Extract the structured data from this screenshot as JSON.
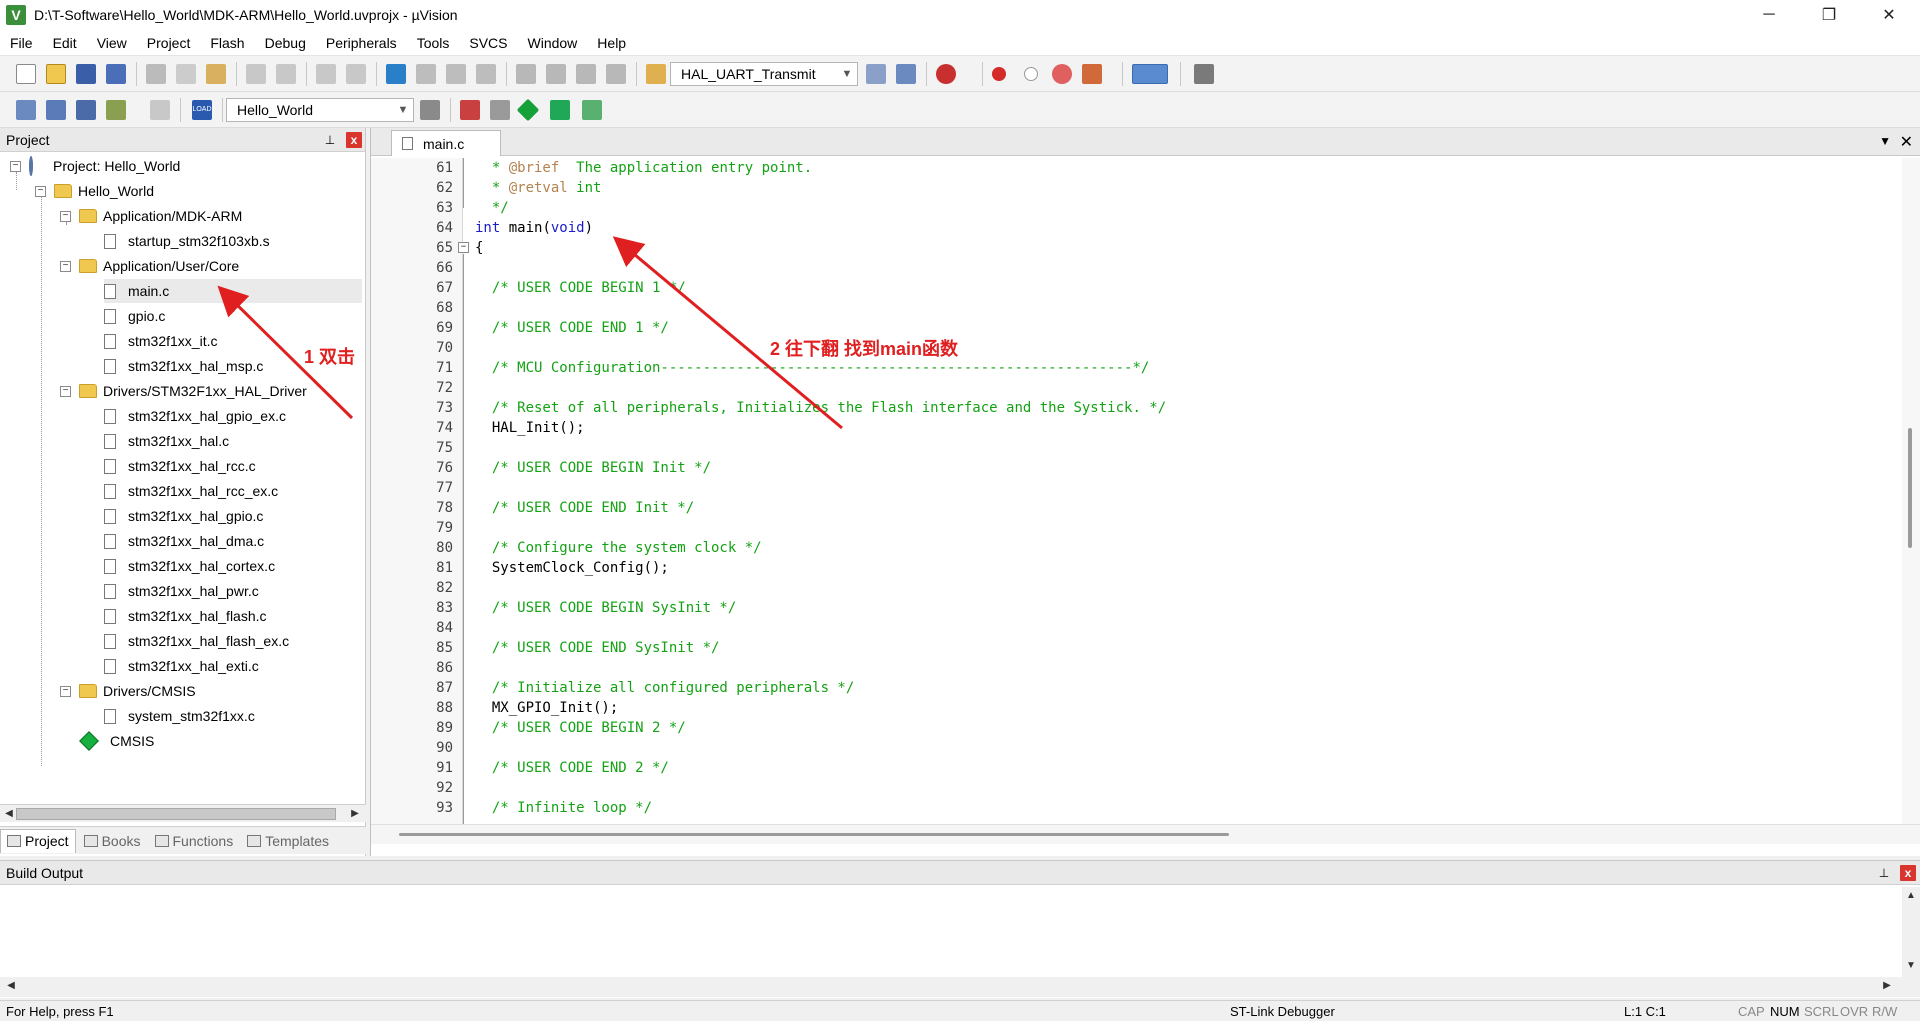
{
  "window": {
    "icon_letter": "V",
    "title": "D:\\T-Software\\Hello_World\\MDK-ARM\\Hello_World.uvprojx - µVision",
    "minimize": "─",
    "maximize": "❐",
    "close": "✕"
  },
  "menu": [
    "File",
    "Edit",
    "View",
    "Project",
    "Flash",
    "Debug",
    "Peripherals",
    "Tools",
    "SVCS",
    "Window",
    "Help"
  ],
  "toolbar": {
    "find_combo_value": "HAL_UART_Transmit",
    "target_combo_value": "Hello_World",
    "load_label": "LOAD"
  },
  "project_panel": {
    "title": "Project",
    "pin": "📌",
    "close": "x",
    "tree": {
      "root": "Project: Hello_World",
      "target": "Hello_World",
      "groups": [
        {
          "name": "Application/MDK-ARM",
          "files": [
            "startup_stm32f103xb.s"
          ]
        },
        {
          "name": "Application/User/Core",
          "files": [
            "main.c",
            "gpio.c",
            "stm32f1xx_it.c",
            "stm32f1xx_hal_msp.c"
          ]
        },
        {
          "name": "Drivers/STM32F1xx_HAL_Driver",
          "files": [
            "stm32f1xx_hal_gpio_ex.c",
            "stm32f1xx_hal.c",
            "stm32f1xx_hal_rcc.c",
            "stm32f1xx_hal_rcc_ex.c",
            "stm32f1xx_hal_gpio.c",
            "stm32f1xx_hal_dma.c",
            "stm32f1xx_hal_cortex.c",
            "stm32f1xx_hal_pwr.c",
            "stm32f1xx_hal_flash.c",
            "stm32f1xx_hal_flash_ex.c",
            "stm32f1xx_hal_exti.c"
          ]
        },
        {
          "name": "Drivers/CMSIS",
          "files": [
            "system_stm32f1xx.c"
          ]
        }
      ],
      "component": "CMSIS"
    },
    "tabs": [
      "Project",
      "Books",
      "Functions",
      "Templates"
    ]
  },
  "editor": {
    "tab": "main.c",
    "tab_list_arrow": "▼",
    "tab_close": "✕",
    "lines": [
      {
        "n": "61",
        "parts": [
          {
            "t": "  * ",
            "c": "c-comment"
          },
          {
            "t": "@brief",
            "c": "c-doc"
          },
          {
            "t": "  The application entry point.",
            "c": "c-comment"
          }
        ]
      },
      {
        "n": "62",
        "parts": [
          {
            "t": "  * ",
            "c": "c-comment"
          },
          {
            "t": "@retval",
            "c": "c-doc"
          },
          {
            "t": " int",
            "c": "c-comment"
          }
        ]
      },
      {
        "n": "63",
        "parts": [
          {
            "t": "  */",
            "c": "c-comment"
          }
        ]
      },
      {
        "n": "64",
        "parts": [
          {
            "t": "int",
            "c": "c-kw"
          },
          {
            "t": " main(",
            "c": "c-plain"
          },
          {
            "t": "void",
            "c": "c-kw"
          },
          {
            "t": ")",
            "c": "c-plain"
          }
        ]
      },
      {
        "n": "65",
        "parts": [
          {
            "t": "{",
            "c": "c-plain"
          }
        ]
      },
      {
        "n": "66",
        "parts": []
      },
      {
        "n": "67",
        "parts": [
          {
            "t": "  /* USER CODE BEGIN 1 */",
            "c": "c-comment"
          }
        ]
      },
      {
        "n": "68",
        "parts": []
      },
      {
        "n": "69",
        "parts": [
          {
            "t": "  /* USER CODE END 1 */",
            "c": "c-comment"
          }
        ]
      },
      {
        "n": "70",
        "parts": []
      },
      {
        "n": "71",
        "parts": [
          {
            "t": "  /* MCU Configuration--------------------------------------------------------*/",
            "c": "c-comment"
          }
        ]
      },
      {
        "n": "72",
        "parts": []
      },
      {
        "n": "73",
        "parts": [
          {
            "t": "  /* Reset of all peripherals, Initializes the Flash interface and the Systick. */",
            "c": "c-comment"
          }
        ]
      },
      {
        "n": "74",
        "parts": [
          {
            "t": "  HAL_Init();",
            "c": "c-plain"
          }
        ]
      },
      {
        "n": "75",
        "parts": []
      },
      {
        "n": "76",
        "parts": [
          {
            "t": "  /* USER CODE BEGIN Init */",
            "c": "c-comment"
          }
        ]
      },
      {
        "n": "77",
        "parts": []
      },
      {
        "n": "78",
        "parts": [
          {
            "t": "  /* USER CODE END Init */",
            "c": "c-comment"
          }
        ]
      },
      {
        "n": "79",
        "parts": []
      },
      {
        "n": "80",
        "parts": [
          {
            "t": "  /* Configure the system clock */",
            "c": "c-comment"
          }
        ]
      },
      {
        "n": "81",
        "parts": [
          {
            "t": "  SystemClock_Config();",
            "c": "c-plain"
          }
        ]
      },
      {
        "n": "82",
        "parts": []
      },
      {
        "n": "83",
        "parts": [
          {
            "t": "  /* USER CODE BEGIN SysInit */",
            "c": "c-comment"
          }
        ]
      },
      {
        "n": "84",
        "parts": []
      },
      {
        "n": "85",
        "parts": [
          {
            "t": "  /* USER CODE END SysInit */",
            "c": "c-comment"
          }
        ]
      },
      {
        "n": "86",
        "parts": []
      },
      {
        "n": "87",
        "parts": [
          {
            "t": "  /* Initialize all configured peripherals */",
            "c": "c-comment"
          }
        ]
      },
      {
        "n": "88",
        "parts": [
          {
            "t": "  MX_GPIO_Init();",
            "c": "c-plain"
          }
        ]
      },
      {
        "n": "89",
        "parts": [
          {
            "t": "  /* USER CODE BEGIN 2 */",
            "c": "c-comment"
          }
        ]
      },
      {
        "n": "90",
        "parts": []
      },
      {
        "n": "91",
        "parts": [
          {
            "t": "  /* USER CODE END 2 */",
            "c": "c-comment"
          }
        ]
      },
      {
        "n": "92",
        "parts": []
      },
      {
        "n": "93",
        "parts": [
          {
            "t": "  /* Infinite loop */",
            "c": "c-comment"
          }
        ]
      }
    ]
  },
  "annotations": {
    "step1": "1 双击",
    "step2": "2 往下翻 找到main函数"
  },
  "build_output": {
    "title": "Build Output",
    "pin": "📌",
    "close": "x"
  },
  "status": {
    "help": "For Help, press F1",
    "debugger": "ST-Link Debugger",
    "position": "L:1 C:1",
    "keys": [
      {
        "label": "CAP",
        "on": false
      },
      {
        "label": "NUM",
        "on": true
      },
      {
        "label": "SCRL",
        "on": false
      },
      {
        "label": "OVR",
        "on": false
      },
      {
        "label": "R/W",
        "on": false
      }
    ]
  },
  "colors": {
    "comment": "#14a214",
    "keyword": "#1c1cc8",
    "doc_tag": "#b4824f",
    "annotation": "#e02020"
  }
}
